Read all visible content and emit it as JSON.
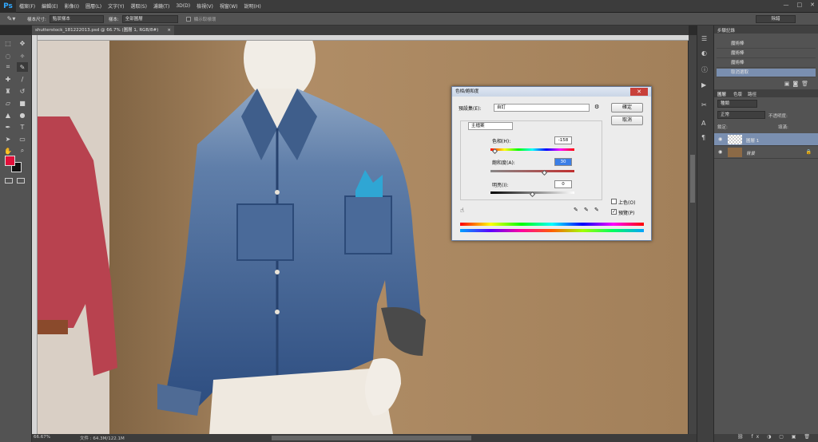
{
  "app": {
    "logo": "Ps"
  },
  "menu": [
    "檔案(F)",
    "編輯(E)",
    "影像(I)",
    "圖層(L)",
    "文字(Y)",
    "選取(S)",
    "濾鏡(T)",
    "3D(D)",
    "檢視(V)",
    "視窗(W)",
    "說明(H)"
  ],
  "window_controls": [
    "—",
    "□",
    "✕"
  ],
  "options": {
    "size_label": "樣本尺寸:",
    "size_value": "點狀樣本",
    "sample_label": "樣本:",
    "sample_value": "全部圖層",
    "ring_label": "顯示取樣環",
    "workspace": "除錯"
  },
  "document": {
    "tab_title": "shutterstock_181222013.psd @ 66.7% (圖層 1, RGB/8#)",
    "tab_close": "×"
  },
  "status": {
    "zoom": "66.67%",
    "doc": "文件 : 64.3M/122.1M"
  },
  "history": {
    "title": "步驟記錄",
    "items": [
      "魔術棒",
      "魔術棒",
      "魔術棒",
      "取消選取"
    ]
  },
  "layers": {
    "tabs": [
      "圖層",
      "色版",
      "路徑"
    ],
    "filter": "種類",
    "blend_mode": "正常",
    "opacity_label": "不透明度:",
    "lock_label": "鎖定:",
    "fill_label": "填滿:",
    "items": [
      {
        "name": "圖層 1",
        "active": true
      },
      {
        "name": "背景",
        "active": false
      }
    ]
  },
  "dialog": {
    "title": "色相/飽和度",
    "close": "✕",
    "preset_label": "預設集(E):",
    "preset_value": "自訂",
    "ok": "確定",
    "cancel": "取消",
    "channel": "主檔案",
    "hue_label": "色相(H):",
    "hue_value": "-158",
    "sat_label": "飽和度(A):",
    "sat_value": "30",
    "light_label": "明亮(I):",
    "light_value": "0",
    "colorize_label": "上色(O)",
    "preview_label": "預覽(P)",
    "colorize_checked": false,
    "preview_checked": true,
    "hue_level": -158,
    "sat_level": 30,
    "light_level": 0
  },
  "colors": {
    "foreground": "#e0103a",
    "background": "#111111",
    "accent": "#31a8ff"
  }
}
